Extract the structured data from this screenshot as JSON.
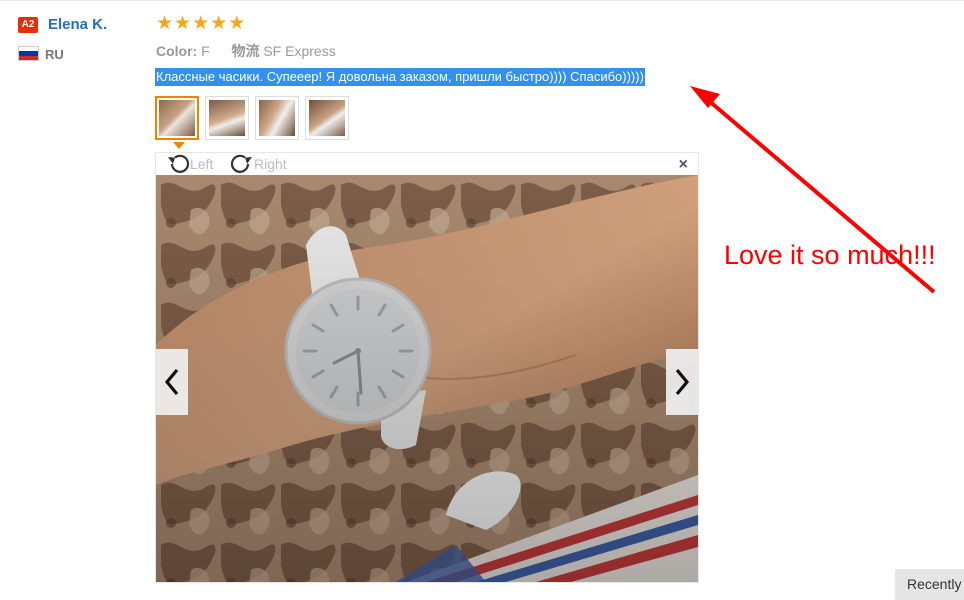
{
  "reviewer": {
    "level_badge": "A2",
    "name": "Elena K.",
    "country_code": "RU",
    "flag_colors": [
      "#ffffff",
      "#0039a6",
      "#d52b1e"
    ]
  },
  "review": {
    "rating": 5,
    "max_rating": 5,
    "star_color": "#f7a71c",
    "color_label": "Color:",
    "color_value": "F",
    "shipping_label": "物流",
    "shipping_value": "SF Express",
    "text": "Классные часики. Супееер! Я довольна заказом, пришли быстро)))) Спасибо)))))",
    "text_highlight_color": "#3290ee"
  },
  "gallery": {
    "thumbnails": [
      {
        "icon": "watch-photo-thumbnail",
        "active": true
      },
      {
        "icon": "watch-photo-thumbnail",
        "active": false
      },
      {
        "icon": "watch-photo-thumbnail",
        "active": false
      },
      {
        "icon": "watch-photo-thumbnail",
        "active": false
      }
    ],
    "active_border_color": "#f08200",
    "rotate_left_label": "Left",
    "rotate_right_label": "Right",
    "close_icon": "×",
    "prev_icon": "chevron-left-icon",
    "next_icon": "chevron-right-icon"
  },
  "annotation": {
    "text": "Love it so much!!!",
    "color": "#ff0000"
  },
  "recently_tab": {
    "label": "Recently"
  }
}
